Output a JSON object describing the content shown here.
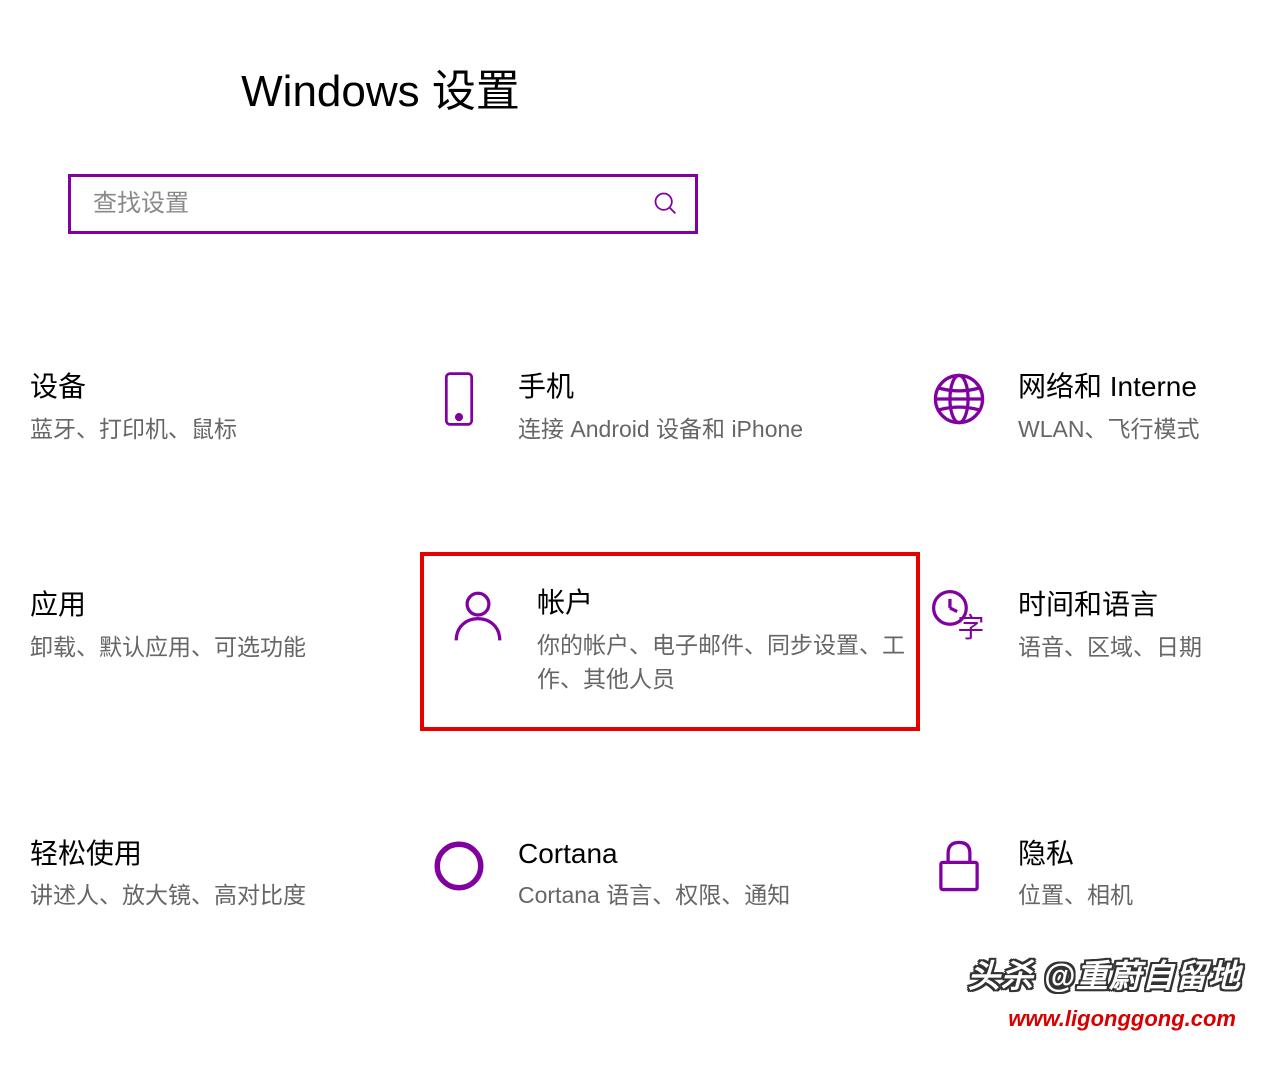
{
  "header": {
    "title": "Windows 设置"
  },
  "search": {
    "placeholder": "查找设置"
  },
  "accent_color": "#8000a0",
  "categories": {
    "row1": [
      {
        "title": "设备",
        "desc": "蓝牙、打印机、鼠标",
        "icon": "none"
      },
      {
        "title": "手机",
        "desc": "连接 Android 设备和 iPhone",
        "icon": "phone"
      },
      {
        "title": "网络和 Interne",
        "desc": "WLAN、飞行模式",
        "icon": "globe"
      }
    ],
    "row2": [
      {
        "title": "应用",
        "desc": "卸载、默认应用、可选功能",
        "icon": "none"
      },
      {
        "title": "帐户",
        "desc": "你的帐户、电子邮件、同步设置、工作、其他人员",
        "icon": "person",
        "highlighted": true
      },
      {
        "title": "时间和语言",
        "desc": "语音、区域、日期",
        "icon": "time-language"
      }
    ],
    "row3": [
      {
        "title": "轻松使用",
        "desc": "讲述人、放大镜、高对比度",
        "icon": "none"
      },
      {
        "title": "Cortana",
        "desc": "Cortana 语言、权限、通知",
        "icon": "cortana"
      },
      {
        "title": "隐私",
        "desc": "位置、相机",
        "icon": "lock"
      }
    ]
  },
  "watermarks": {
    "line1": "头杀 @重蔚自留地",
    "line2": "www.ligonggong.com"
  }
}
